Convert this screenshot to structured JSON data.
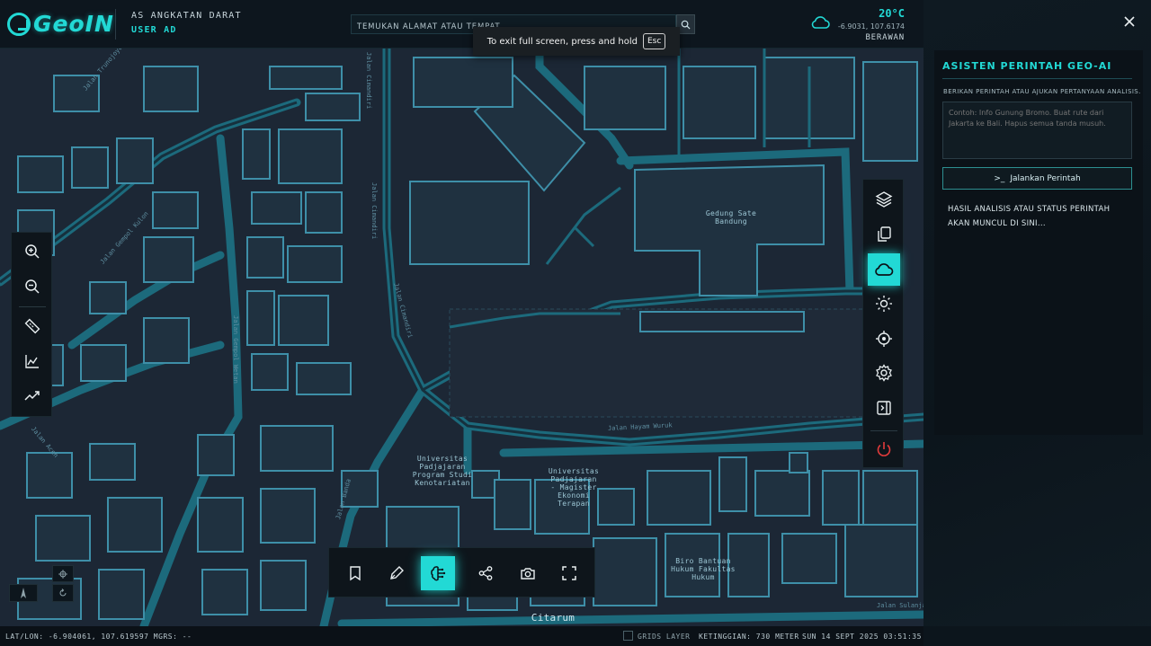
{
  "header": {
    "logo_text": "GeoIN",
    "unit_title": "AS ANGKATAN DARAT",
    "user_label": "USER AD",
    "search": {
      "placeholder": "TEMUKAN ALAMAT ATAU TEMPAT"
    },
    "fullscreen_toast": {
      "text": "To exit full screen, press and hold",
      "key": "Esc"
    },
    "weather": {
      "temperature": "20°C",
      "coords": "-6.9031, 107.6174",
      "condition": "BERAWAN",
      "icon": "cloud-icon"
    }
  },
  "panel": {
    "title": "ASISTEN PERINTAH GEO-AI",
    "subtitle": "BERIKAN PERINTAH ATAU AJUKAN PERTANYAAN ANALISIS.",
    "textarea_placeholder": "Contoh: Info Gunung Bromo. Buat rute dari Jakarta ke Bali. Hapus semua tanda musuh.",
    "run_prompt_glyph": ">_",
    "run_button": "Jalankan Perintah",
    "result_text": "HASIL ANALISIS ATAU STATUS PERINTAH AKAN MUNCUL DI SINI..."
  },
  "map": {
    "labels": {
      "gedung_sate": "Gedung Sate\nBandung",
      "unpad_notariat": "Universitas\nPadjajaran\nProgram Studi\nKenotariatan",
      "unpad_magister": "Universitas\nPadjajaran\n- Magister\nEkonomi\nTerapan",
      "biro_bantuan": "Biro Bantuan\nHukum Fakultas\nHukum",
      "citarum": "Citarum"
    },
    "streets": {
      "hayam_wuruk": "Jalan Hayam Wuruk",
      "cimandiri_1": "Jalan Cimandiri",
      "cimandiri_2": "Jalan Cimandiri",
      "cimandiri_3": "Jalan Cimandiri",
      "gempol_wetan": "Jalan Gempol Wetan",
      "gempol_kulon": "Jalan Gempol Kulon",
      "banda": "Jalan Banda",
      "trunojoyo": "Jalan Trunojoyo",
      "sulanjana": "Jalan Sulanjana",
      "aceh": "Jalan Aceh"
    }
  },
  "left_toolbar": [
    {
      "name": "zoom-in-icon"
    },
    {
      "name": "zoom-out-icon"
    },
    {
      "name": "ruler-icon"
    },
    {
      "name": "area-chart-icon"
    },
    {
      "name": "trend-icon"
    }
  ],
  "right_toolbar": [
    {
      "name": "layers-icon"
    },
    {
      "name": "copy-icon"
    },
    {
      "name": "cloud-icon",
      "active": true
    },
    {
      "name": "sun-icon"
    },
    {
      "name": "crosshair-icon"
    },
    {
      "name": "gear-icon"
    },
    {
      "name": "sidebar-toggle-icon"
    },
    {
      "name": "power-icon"
    }
  ],
  "bottom_toolbar": [
    {
      "name": "bookmark-icon"
    },
    {
      "name": "pen-icon"
    },
    {
      "name": "brain-ai-icon",
      "active": true
    },
    {
      "name": "share-icon"
    },
    {
      "name": "camera-icon"
    },
    {
      "name": "fullscreen-icon"
    }
  ],
  "statusbar": {
    "latlon": "LAT/LON: -6.904061, 107.619597  MGRS: --",
    "grids_layer": "GRIDS LAYER",
    "altitude": "KETINGGIAN: 730 METER",
    "datetime": "SUN 14 SEPT 2025 03:51:35"
  },
  "colors": {
    "accent": "#22d9d5",
    "danger": "#e23b3b",
    "map_bg": "#1c2735",
    "road": "#1f6f80",
    "building": "#3e8fa8"
  }
}
